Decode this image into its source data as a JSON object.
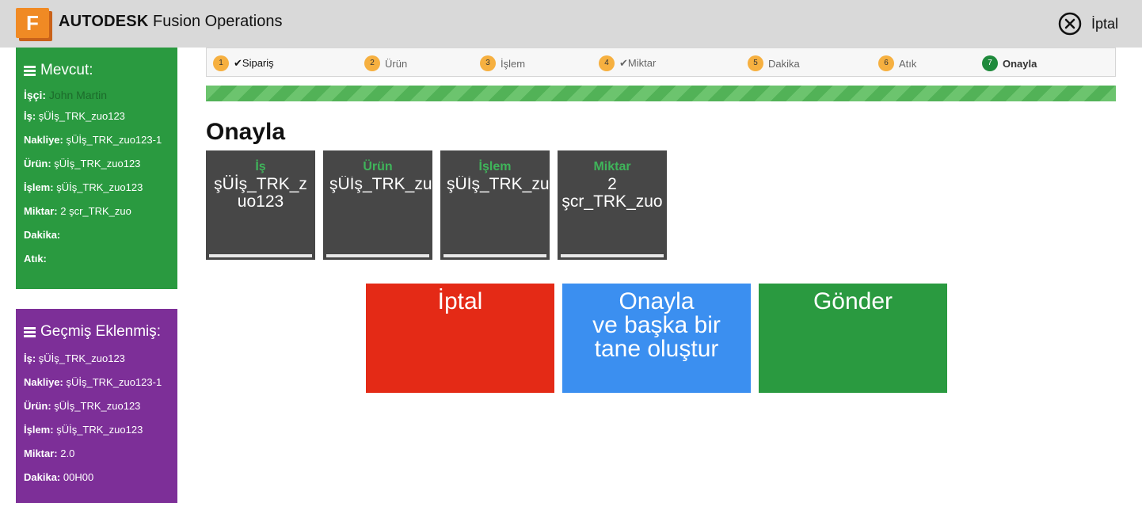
{
  "header": {
    "logo_letter": "F",
    "brand": "AUTODESK",
    "product": "Fusion Operations",
    "cancel_label": "İptal"
  },
  "current": {
    "title": "Mevcut:",
    "worker_label": "İşçi:",
    "worker_value": "John Martin",
    "rows": [
      {
        "label": "İş:",
        "value": "şÜİş_TRK_zuo123"
      },
      {
        "label": "Nakliye:",
        "value": "şÜİş_TRK_zuo123-1"
      },
      {
        "label": "Ürün:",
        "value": "şÜİş_TRK_zuo123"
      },
      {
        "label": "İşlem:",
        "value": "şÜİş_TRK_zuo123"
      },
      {
        "label": "Miktar:",
        "value": "2 şcr_TRK_zuo"
      },
      {
        "label": "Dakika:",
        "value": ""
      },
      {
        "label": "Atık:",
        "value": ""
      }
    ]
  },
  "history": {
    "title": "Geçmiş Eklenmiş:",
    "rows": [
      {
        "label": "İş:",
        "value": "şÜİş_TRK_zuo123"
      },
      {
        "label": "Nakliye:",
        "value": "şÜİş_TRK_zuo123-1"
      },
      {
        "label": "Ürün:",
        "value": "şÜİş_TRK_zuo123"
      },
      {
        "label": "İşlem:",
        "value": "şÜİş_TRK_zuo123"
      },
      {
        "label": "Miktar:",
        "value": "2.0"
      },
      {
        "label": "Dakika:",
        "value": "00H00"
      }
    ]
  },
  "steps": [
    {
      "num": "1",
      "label": "Sipariş",
      "check": "✔"
    },
    {
      "num": "2",
      "label": "Ürün",
      "check": ""
    },
    {
      "num": "3",
      "label": "İşlem",
      "check": ""
    },
    {
      "num": "4",
      "label": "Miktar",
      "check": "✔"
    },
    {
      "num": "5",
      "label": "Dakika",
      "check": ""
    },
    {
      "num": "6",
      "label": "Atık",
      "check": ""
    },
    {
      "num": "7",
      "label": "Onayla",
      "check": ""
    }
  ],
  "active_step": 7,
  "page_title": "Onayla",
  "cards": [
    {
      "title": "İş",
      "value": "şÜİş_TRK_zuo123"
    },
    {
      "title": "Ürün",
      "value": "şÜİş_TRK_zuo"
    },
    {
      "title": "İşlem",
      "value": "şÜİş_TRK_zuo"
    },
    {
      "title": "Miktar",
      "value_line1": "2",
      "value_line2": "şcr_TRK_zuo"
    }
  ],
  "buttons": {
    "cancel": "İptal",
    "confirm_line1": "Onayla",
    "confirm_line2": "ve başka bir",
    "confirm_line3": "tane oluştur",
    "submit": "Gönder"
  },
  "colors": {
    "green": "#2a9a40",
    "purple": "#7d2f98",
    "red": "#e42a16",
    "blue": "#3b8ff0",
    "orange": "#f08a24"
  }
}
